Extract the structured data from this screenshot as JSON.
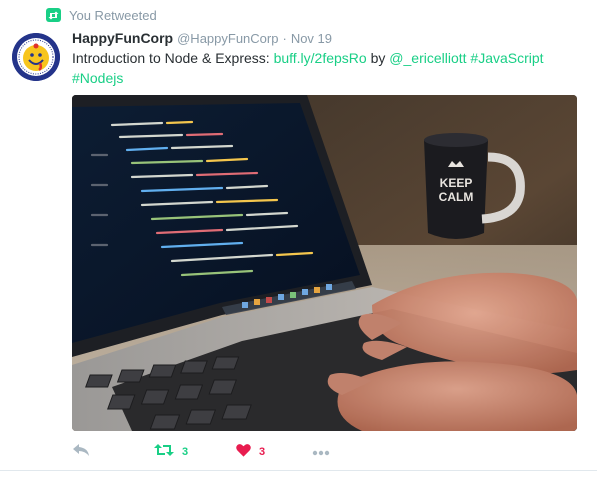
{
  "context": {
    "label": "You Retweeted"
  },
  "tweet": {
    "fullname": "HappyFunCorp",
    "username": "@HappyFunCorp",
    "separator": "·",
    "timestamp": "Nov 19",
    "text_parts": {
      "intro": "Introduction to Node & Express: ",
      "link": "buff.ly/2fepsRo",
      "by": " by ",
      "mention": "@_ericelliott",
      "space": " ",
      "hashtag1": "#JavaScript",
      "hashtag2": "#Nodejs"
    },
    "media": {
      "screen_text": {
        "mug_line1": "KEEP",
        "mug_line2": "CALM"
      }
    }
  },
  "actions": {
    "reply_icon": "reply-icon",
    "retweet_icon": "retweet-icon",
    "retweet_count": "3",
    "like_icon": "heart-icon",
    "like_count": "3",
    "more_icon": "more-icon"
  },
  "colors": {
    "accent_green": "#19cf86",
    "like_red": "#e81c4f",
    "muted": "#8899a6",
    "text": "#292f33"
  }
}
